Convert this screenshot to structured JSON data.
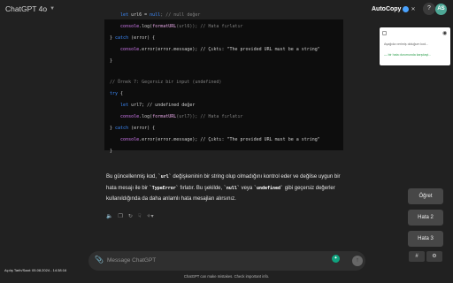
{
  "header": {
    "model": "ChatGPT 4o",
    "autocopy_label": "AutoCopy",
    "help": "?",
    "avatar_initials": "AS"
  },
  "code_lines": [
    {
      "parts": [
        {
          "t": "    ",
          "c": ""
        },
        {
          "t": "let",
          "c": "c-kw"
        },
        {
          "t": " url6 = ",
          "c": ""
        },
        {
          "t": "null",
          "c": "c-kw"
        },
        {
          "t": "; // null değer",
          "c": "c-comment"
        }
      ]
    },
    {
      "parts": [
        {
          "t": "    ",
          "c": ""
        },
        {
          "t": "console",
          "c": "c-mag"
        },
        {
          "t": ".log(",
          "c": ""
        },
        {
          "t": "formatURL",
          "c": "c-fn"
        },
        {
          "t": "(url6)); // Hata fırlatır",
          "c": "c-comment"
        }
      ]
    },
    {
      "parts": [
        {
          "t": "} ",
          "c": ""
        },
        {
          "t": "catch",
          "c": "c-kw"
        },
        {
          "t": " (error) {",
          "c": ""
        }
      ]
    },
    {
      "parts": [
        {
          "t": "    ",
          "c": ""
        },
        {
          "t": "console",
          "c": "c-mag"
        },
        {
          "t": ".error(error.message); // Çıktı: \"The provided URL must be a string\"",
          "c": ""
        }
      ]
    },
    {
      "parts": [
        {
          "t": "}",
          "c": ""
        }
      ]
    },
    {
      "parts": [
        {
          "t": "",
          "c": ""
        }
      ]
    },
    {
      "parts": [
        {
          "t": "// Örnek 7: Geçersiz bir input (undefined)",
          "c": "c-comment"
        }
      ]
    },
    {
      "parts": [
        {
          "t": "try",
          "c": "c-kw"
        },
        {
          "t": " {",
          "c": ""
        }
      ]
    },
    {
      "parts": [
        {
          "t": "    ",
          "c": ""
        },
        {
          "t": "let",
          "c": "c-kw"
        },
        {
          "t": " url7; // undefined değer",
          "c": ""
        }
      ]
    },
    {
      "parts": [
        {
          "t": "    ",
          "c": ""
        },
        {
          "t": "console",
          "c": "c-mag"
        },
        {
          "t": ".log(",
          "c": ""
        },
        {
          "t": "formatURL",
          "c": "c-fn"
        },
        {
          "t": "(url7)); // Hata fırlatır",
          "c": "c-comment"
        }
      ]
    },
    {
      "parts": [
        {
          "t": "} ",
          "c": ""
        },
        {
          "t": "catch",
          "c": "c-kw"
        },
        {
          "t": " (error) {",
          "c": ""
        }
      ]
    },
    {
      "parts": [
        {
          "t": "    ",
          "c": ""
        },
        {
          "t": "console",
          "c": "c-mag"
        },
        {
          "t": ".error(error.message); // Çıktı: \"The provided URL must be a string\"",
          "c": ""
        }
      ]
    },
    {
      "parts": [
        {
          "t": "}",
          "c": ""
        }
      ]
    }
  ],
  "prose": {
    "p1a": "Bu güncellenmiş kod, ",
    "code1": "`url`",
    "p1b": " değişkeninin bir string olup olmadığını kontrol eder ve değilse uygun bir hata mesajı ile bir ",
    "code2": "`TypeError`",
    "p1c": " fırlatır. Bu şekilde, ",
    "code3": "`null`",
    "p1d": " veya ",
    "code4": "`undefined`",
    "p1e": " gibi geçersiz değerler kullanıldığında da daha anlamlı hata mesajları alırsınız."
  },
  "message_actions": [
    "speaker-icon",
    "copy-icon",
    "regenerate-icon",
    "thumbs-down-icon",
    "model-switch-icon"
  ],
  "extension_panel": {
    "item1": "Aşağıda verimiş olduğum kod...",
    "item2": "— bir hata durumunda karşılaşt..."
  },
  "side_buttons": [
    "Öğret",
    "Hata 2",
    "Hata 3"
  ],
  "small_buttons": [
    "#",
    "⚙"
  ],
  "composer": {
    "placeholder": "Message ChatGPT"
  },
  "footer": "ChatGPT can make mistakes. Check important info.",
  "datetime": "Açılış Tarih/Saat: 05.08.2024 - 14:38:16"
}
